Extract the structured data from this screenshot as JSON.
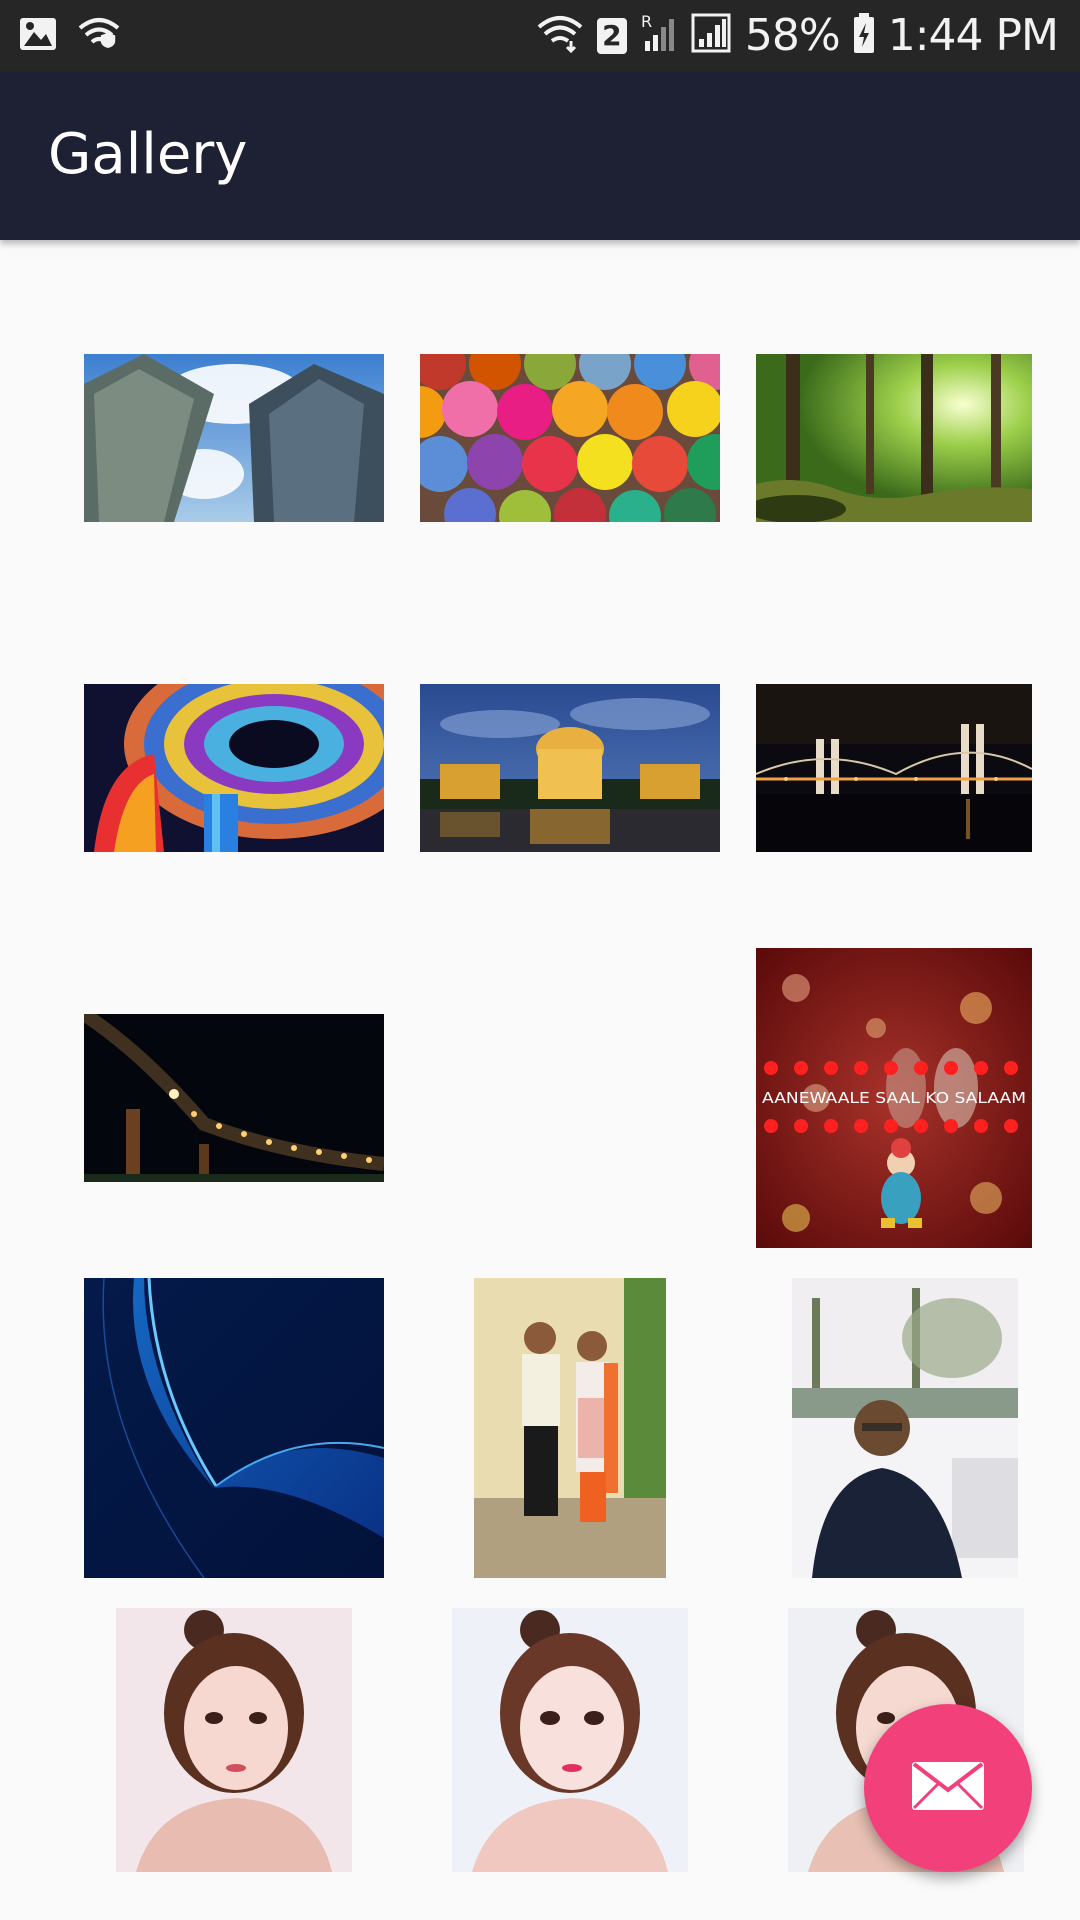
{
  "status_bar": {
    "left_icons": [
      "image-icon",
      "wifi-secure-icon"
    ],
    "right_icons": [
      "wifi-data-icon",
      "sim-2-icon",
      "roaming-signal-icon",
      "signal-icon",
      "battery-charging-icon"
    ],
    "sim_label": "2",
    "roaming_label": "R",
    "battery_text": "58%",
    "time": "1:44 PM"
  },
  "app_bar": {
    "title": "Gallery",
    "background_color": "#1e2133"
  },
  "gallery": {
    "images": [
      {
        "name": "image-skyscrapers",
        "subject": "skyscrapers"
      },
      {
        "name": "image-yarn-balls",
        "subject": "yarn-balls"
      },
      {
        "name": "image-forest",
        "subject": "forest"
      },
      {
        "name": "image-stained-glass-dome",
        "subject": "stained-glass-dome"
      },
      {
        "name": "image-palace-night",
        "subject": "palace-night"
      },
      {
        "name": "image-bridge-night",
        "subject": "bridge-night"
      },
      {
        "name": "image-overpass-lights",
        "subject": "overpass-lights"
      },
      {
        "name": "image-hearts-greeting",
        "subject": "hearts-greeting",
        "overlay_text": "AANEWAALE SAAL KO SALAAM"
      },
      {
        "name": "image-blue-wave",
        "subject": "blue-wave"
      },
      {
        "name": "image-couple-portrait",
        "subject": "couple-portrait"
      },
      {
        "name": "image-man-selfie",
        "subject": "man-selfie"
      },
      {
        "name": "image-girl-portrait-1",
        "subject": "girl-portrait"
      },
      {
        "name": "image-girl-portrait-2",
        "subject": "girl-portrait"
      },
      {
        "name": "image-girl-portrait-3",
        "subject": "girl-portrait"
      }
    ]
  },
  "fab": {
    "icon": "mail-icon",
    "color": "#f2417a"
  }
}
